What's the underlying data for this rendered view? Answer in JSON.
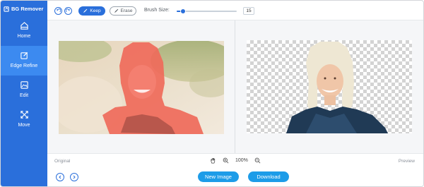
{
  "app": {
    "title": "BG Remover",
    "accent_color": "#2a6fdb",
    "sidebar_color": "#2a6fdb",
    "active_color": "#3c8af0",
    "pill_color": "#1d9ce8"
  },
  "sidebar": {
    "items": [
      {
        "label": "Home",
        "icon": "home-icon",
        "active": false
      },
      {
        "label": "Edge Refine",
        "icon": "edit-square-icon",
        "active": true
      },
      {
        "label": "Edit",
        "icon": "image-edit-icon",
        "active": false
      },
      {
        "label": "Move",
        "icon": "move-arrows-icon",
        "active": false
      }
    ]
  },
  "toolbar": {
    "undo_icon": "undo-icon",
    "redo_icon": "redo-icon",
    "keep_label": "Keep",
    "erase_label": "Erase",
    "brush_label": "Brush Size:",
    "brush_value": "15",
    "brush_level": 0.1
  },
  "canvas": {
    "original_label": "Original",
    "preview_label": "Preview",
    "zoom_level": "100%"
  },
  "footer": {
    "new_image_label": "New Image",
    "download_label": "Download"
  }
}
